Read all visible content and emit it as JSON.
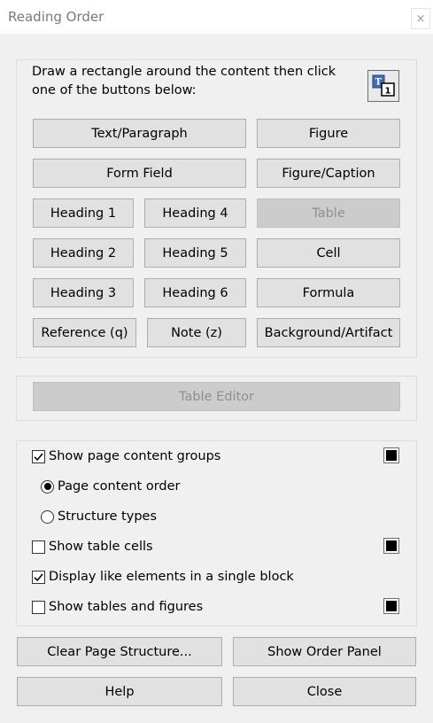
{
  "window": {
    "title": "Reading Order",
    "close_glyph": "×"
  },
  "tagging": {
    "instruction": "Draw a rectangle around the content then click one of the buttons below:",
    "tool_icon": "touch-up-reading-order-icon",
    "buttons": {
      "text_paragraph": "Text/Paragraph",
      "figure": "Figure",
      "form_field": "Form Field",
      "figure_caption": "Figure/Caption",
      "heading_1": "Heading 1",
      "heading_4": "Heading 4",
      "table": "Table",
      "heading_2": "Heading 2",
      "heading_5": "Heading 5",
      "cell": "Cell",
      "heading_3": "Heading 3",
      "heading_6": "Heading 6",
      "formula": "Formula",
      "reference": "Reference (q)",
      "note": "Note (z)",
      "background_artifact": "Background/Artifact"
    }
  },
  "table_editor": {
    "label": "Table Editor"
  },
  "display_options": {
    "show_page_content_groups": {
      "label": "Show page content groups",
      "checked": true,
      "color": "#000000"
    },
    "page_content_order": {
      "label": "Page content order",
      "selected": true
    },
    "structure_types": {
      "label": "Structure types",
      "selected": false
    },
    "show_table_cells": {
      "label": "Show table cells",
      "checked": false,
      "color": "#000000"
    },
    "display_like_elements": {
      "label": "Display like elements in a single block",
      "checked": true
    },
    "show_tables_and_figures": {
      "label": "Show tables and figures",
      "checked": false,
      "color": "#000000"
    }
  },
  "footer": {
    "clear_page_structure": "Clear Page Structure...",
    "show_order_panel": "Show Order Panel",
    "help": "Help",
    "close": "Close"
  }
}
